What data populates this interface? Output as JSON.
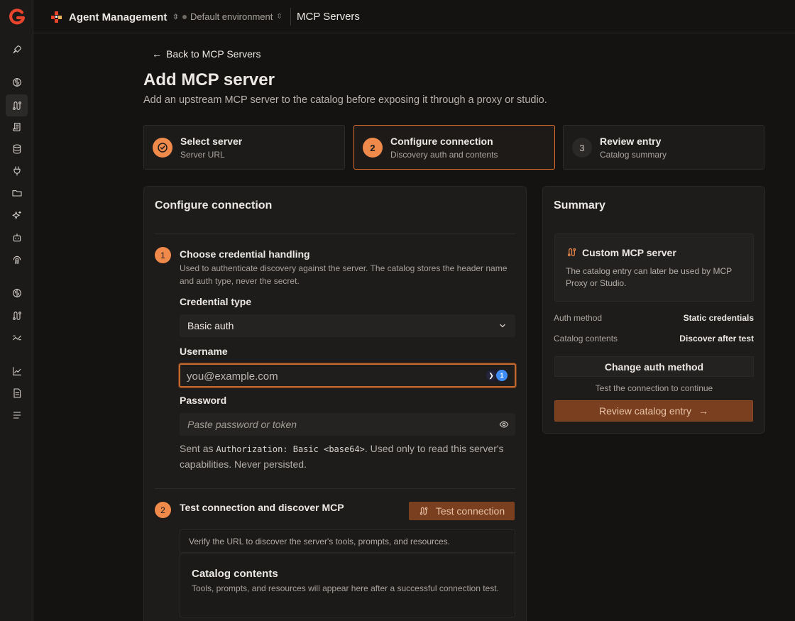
{
  "topbar": {
    "app_name": "Agent Management",
    "environment": "Default environment",
    "page": "MCP Servers"
  },
  "rail_icons": [
    "logo-icon",
    "rocket-icon",
    "brain-icon",
    "route-icon",
    "scroll-icon",
    "database-icon",
    "plug-icon",
    "folder-icon",
    "sparkles-icon",
    "bot-icon",
    "fingerprint-icon",
    "brain-icon",
    "route-icon",
    "waypoints-icon",
    "chart-icon",
    "document-icon",
    "list-icon"
  ],
  "back_link": "Back to MCP Servers",
  "title": "Add MCP server",
  "subtitle": "Add an upstream MCP server to the catalog before exposing it through a proxy or studio.",
  "steps": [
    {
      "title": "Select server",
      "desc": "Server URL",
      "state": "done"
    },
    {
      "num": "2",
      "title": "Configure connection",
      "desc": "Discovery auth and contents",
      "state": "current"
    },
    {
      "num": "3",
      "title": "Review entry",
      "desc": "Catalog summary",
      "state": "pending"
    }
  ],
  "config": {
    "title": "Configure connection",
    "section1": {
      "num": "1",
      "title": "Choose credential handling",
      "desc": "Used to authenticate discovery against the server. The catalog stores the header name and auth type, never the secret.",
      "credential_label": "Credential type",
      "credential_value": "Basic auth",
      "username_label": "Username",
      "username_placeholder": "you@example.com",
      "password_label": "Password",
      "password_placeholder": "Paste password or token",
      "hint_pre": "Sent as ",
      "hint_code": "Authorization: Basic <base64>",
      "hint_post": ". Used only to read this server's capabilities. Never persisted."
    },
    "section2": {
      "num": "2",
      "title": "Test connection and discover MCP",
      "test_button": "Test connection",
      "verify_text": "Verify the URL to discover the server's tools, prompts, and resources.",
      "catalog_title": "Catalog contents",
      "catalog_desc": "Tools, prompts, and resources will appear here after a successful connection test."
    }
  },
  "summary": {
    "title": "Summary",
    "server_name": "Custom MCP server",
    "server_desc": "The catalog entry can later be used by MCP Proxy or Studio.",
    "auth_method_label": "Auth method",
    "auth_method_value": "Static credentials",
    "catalog_label": "Catalog contents",
    "catalog_value": "Discover after test",
    "change_button": "Change auth method",
    "note": "Test the connection to continue",
    "review_button": "Review catalog entry"
  },
  "colors": {
    "accent": "#f08a4b",
    "accent_dark": "#7a3f1f",
    "background": "#141312",
    "card": "#1d1c1b"
  }
}
